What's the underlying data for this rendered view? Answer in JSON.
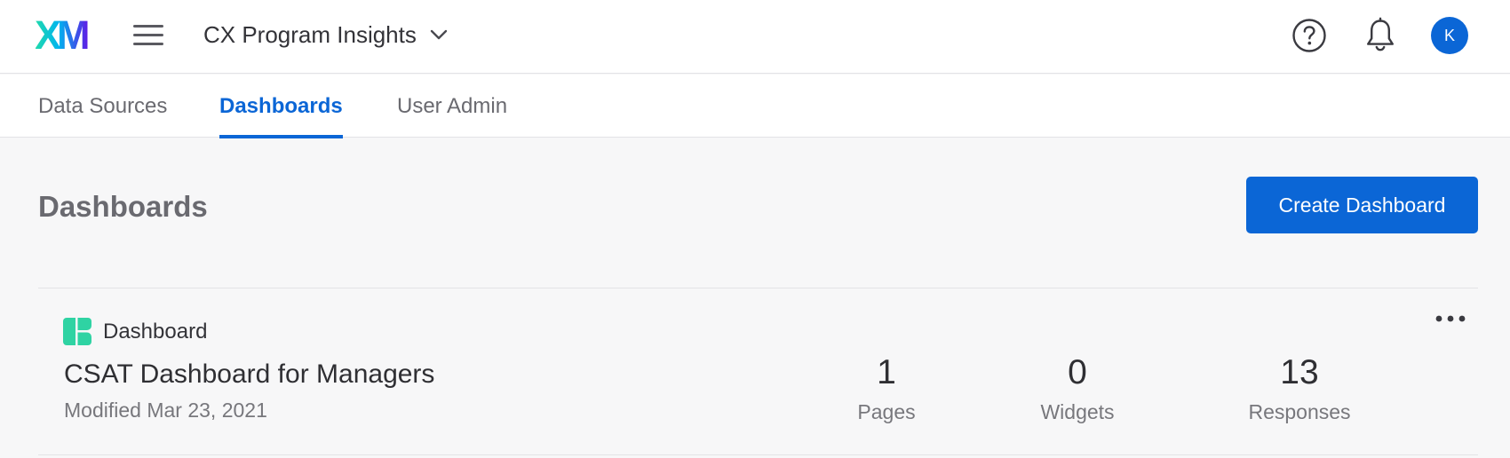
{
  "header": {
    "logo_text": "XM",
    "project_name": "CX Program Insights",
    "avatar_initial": "K"
  },
  "tabs": [
    {
      "label": "Data Sources",
      "active": false
    },
    {
      "label": "Dashboards",
      "active": true
    },
    {
      "label": "User Admin",
      "active": false
    }
  ],
  "page": {
    "title": "Dashboards",
    "create_button_label": "Create Dashboard"
  },
  "dashboards": [
    {
      "type_label": "Dashboard",
      "name": "CSAT Dashboard for Managers",
      "modified": "Modified Mar 23, 2021",
      "stats": [
        {
          "value": "1",
          "label": "Pages"
        },
        {
          "value": "0",
          "label": "Widgets"
        },
        {
          "value": "13",
          "label": "Responses"
        }
      ]
    }
  ],
  "colors": {
    "accent": "#0b66d6",
    "dashboard_icon": "#2fd3a3",
    "background": "#f7f7f8"
  },
  "icons": {
    "logo": "xm-logo",
    "menu": "hamburger-menu-icon",
    "dropdown": "chevron-down-icon",
    "help": "help-circle-icon",
    "notifications": "bell-icon",
    "dashboard_type": "dashboard-icon",
    "more": "more-horizontal-icon"
  }
}
